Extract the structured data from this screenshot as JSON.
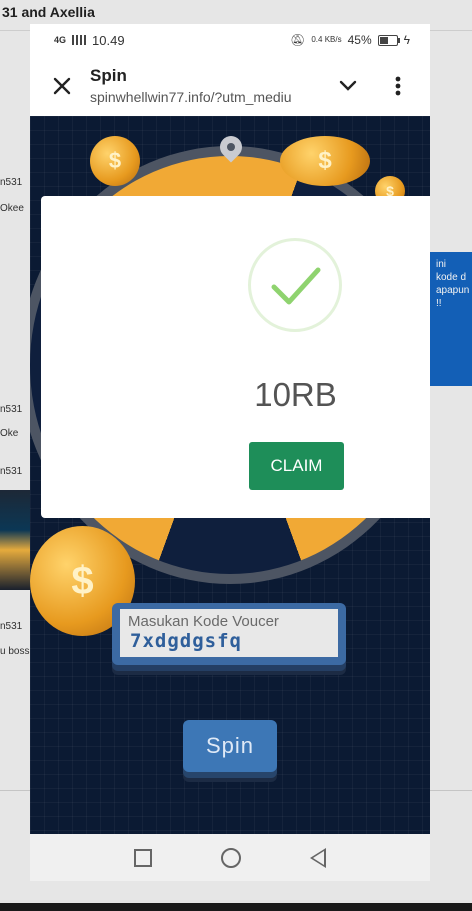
{
  "background": {
    "title": "31 and Axellia",
    "chat_items": [
      "n531",
      "Okee",
      "n531",
      "Oke",
      "n531",
      "n531",
      "u boss"
    ],
    "banner_text": "ini kode d apapun !!"
  },
  "status_bar": {
    "time": "10.49",
    "network": "4G",
    "speed": "0.4 KB/s",
    "battery": "45%"
  },
  "browser": {
    "title": "Spin",
    "url": "spinwhellwin77.info/?utm_mediu"
  },
  "page": {
    "voucher": {
      "placeholder": "Masukan Kode Voucer",
      "value": "7xdgdgsfq"
    },
    "spin_label": "Spin"
  },
  "modal": {
    "amount": "10RB",
    "claim_label": "CLAIM"
  },
  "icons": {
    "close": "close-icon",
    "dropdown": "chevron-down-icon",
    "menu": "more-vert-icon",
    "check": "check-icon"
  },
  "colors": {
    "claim": "#1e8e59",
    "check": "#8fd36f",
    "wheel_bg": "#0b1a33",
    "spin_button": "#3d77b6"
  }
}
